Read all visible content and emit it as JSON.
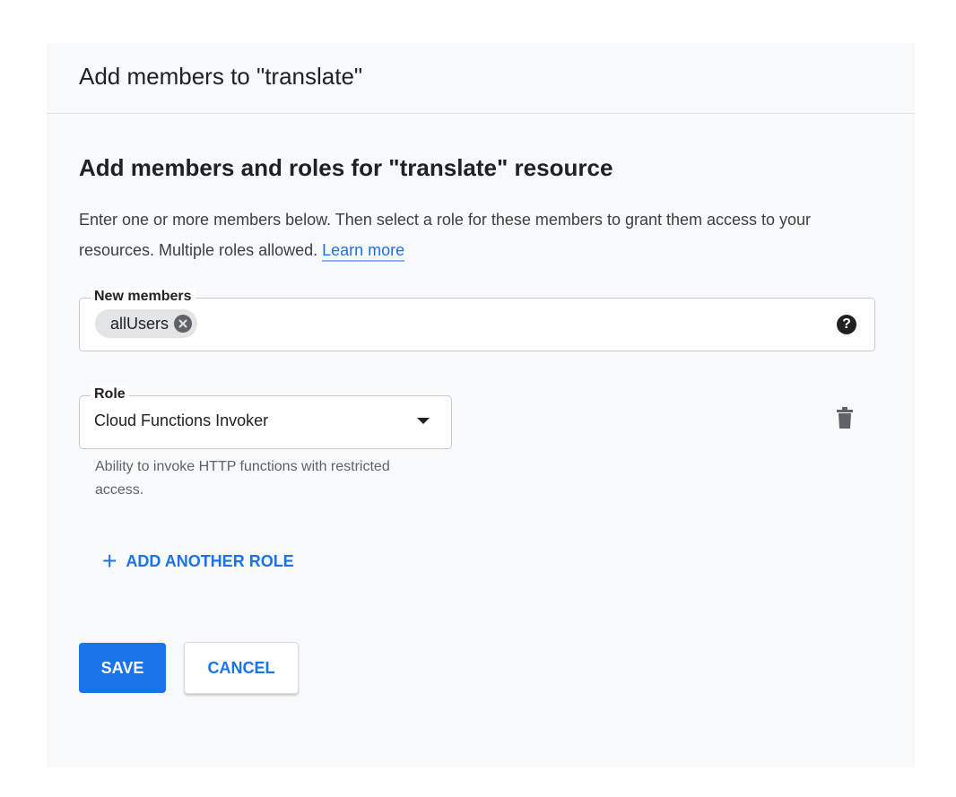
{
  "header": {
    "title": "Add members to \"translate\""
  },
  "section": {
    "title": "Add members and roles for \"translate\" resource",
    "description": "Enter one or more members below. Then select a role for these members to grant them access to your resources. Multiple roles allowed.",
    "learn_more": "Learn more"
  },
  "members": {
    "label": "New members",
    "chips": [
      "allUsers"
    ]
  },
  "role": {
    "label": "Role",
    "value": "Cloud Functions Invoker",
    "hint": "Ability to invoke HTTP functions with restricted access."
  },
  "actions": {
    "add_role": "ADD ANOTHER ROLE",
    "save": "SAVE",
    "cancel": "CANCEL"
  },
  "colors": {
    "accent": "#1a73e8",
    "panel_background": "#f8f9fa"
  },
  "icons": {
    "chip_remove": "close-circle-icon",
    "help": "help-circle-icon",
    "dropdown": "caret-down-icon",
    "delete": "trash-icon",
    "add": "plus-icon"
  }
}
